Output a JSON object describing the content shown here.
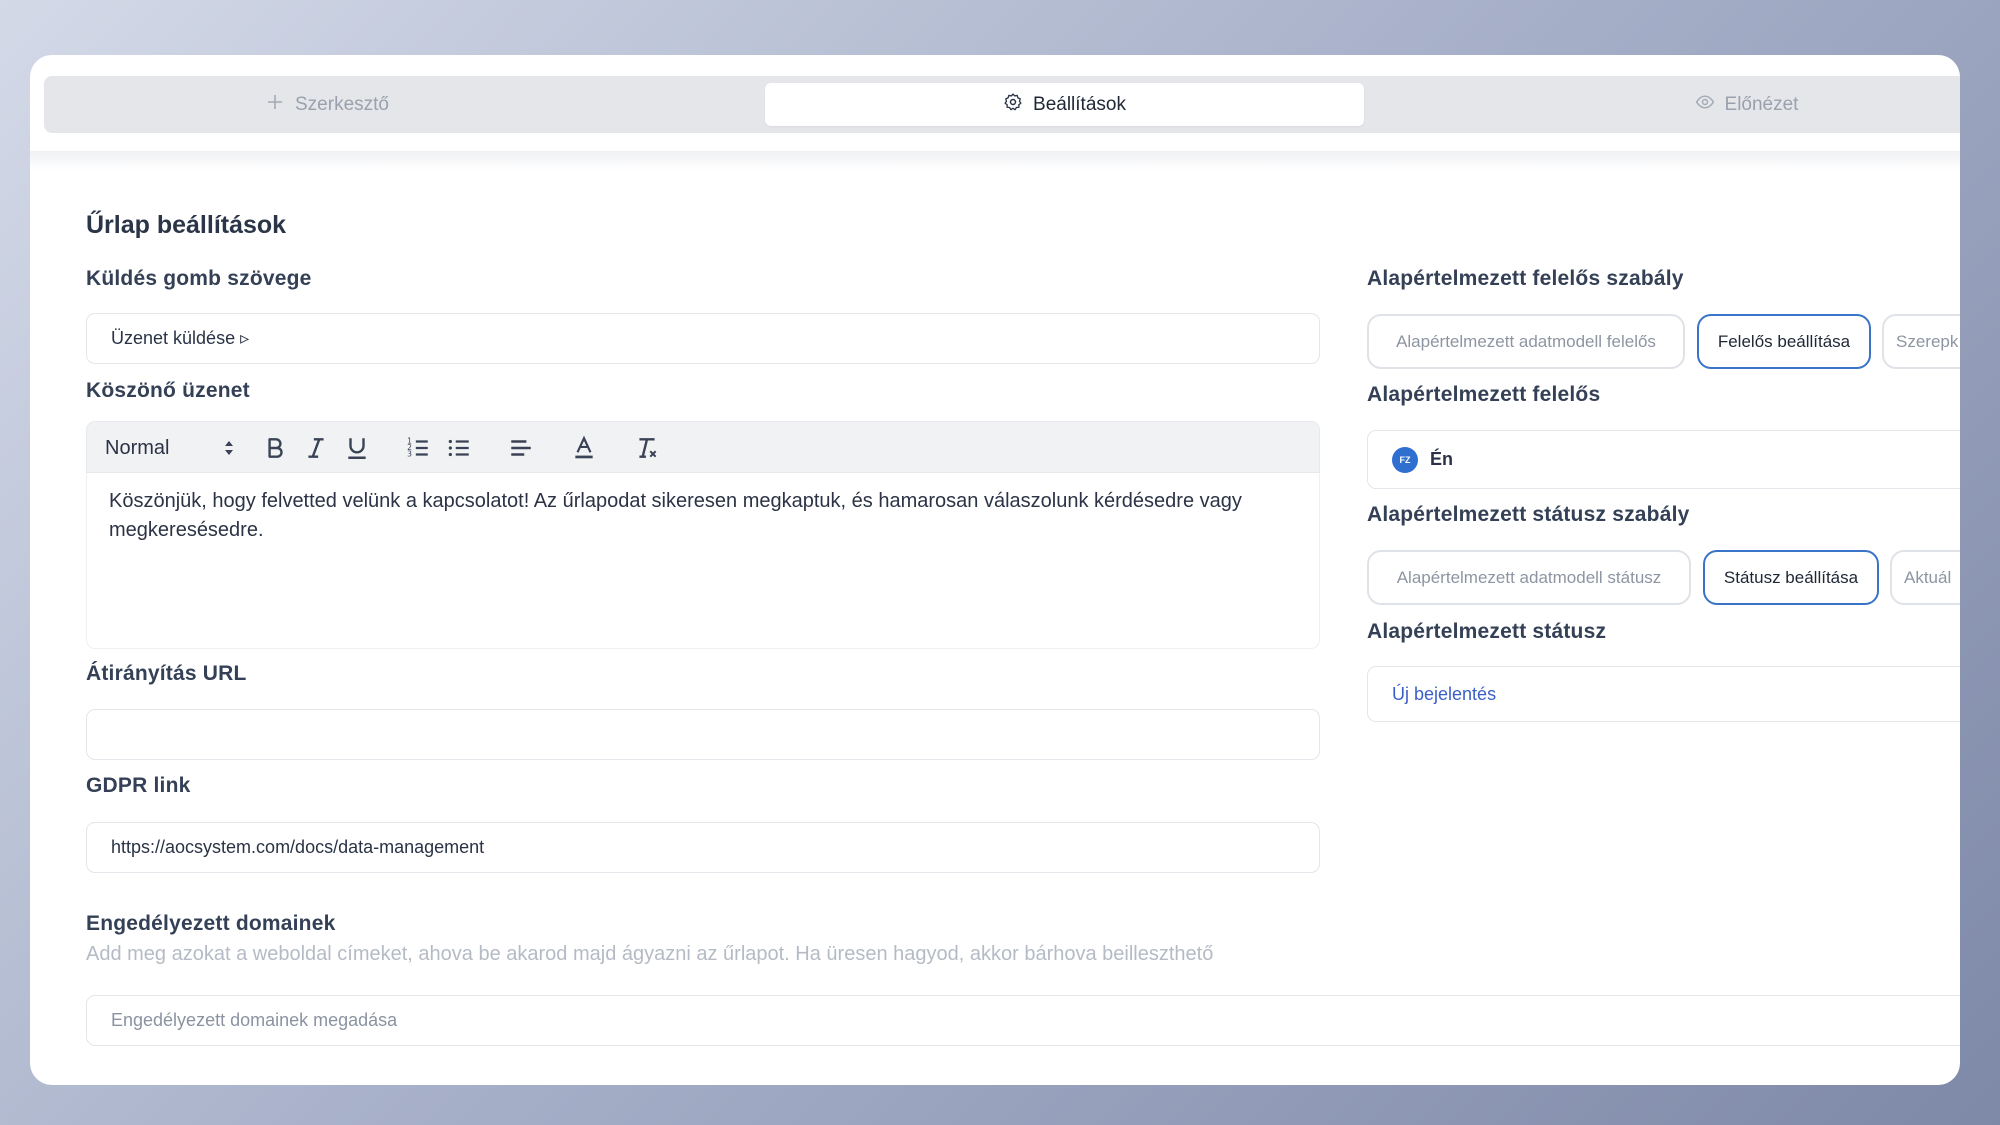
{
  "tabs": [
    {
      "label": "Szerkesztő",
      "icon": "plus-icon"
    },
    {
      "label": "Beállítások",
      "icon": "gear-icon"
    },
    {
      "label": "Előnézet",
      "icon": "eye-icon"
    }
  ],
  "page_title": "Űrlap beállítások",
  "submit": {
    "label": "Küldés gomb szövege",
    "value": "Üzenet küldése ▹"
  },
  "thanks": {
    "label": "Köszönő üzenet",
    "format": "Normal",
    "text": "Köszönjük, hogy felvetted velünk a kapcsolatot! Az űrlapodat sikeresen megkaptuk, és hamarosan válaszolunk kérdésedre vagy megkeresésedre."
  },
  "redirect": {
    "label": "Átirányítás URL",
    "value": ""
  },
  "gdpr": {
    "label": "GDPR link",
    "value": "https://aocsystem.com/docs/data-management"
  },
  "domains": {
    "label": "Engedélyezett domainek",
    "hint": "Add meg azokat a weboldal címeket, ahova be akarod majd ágyazni az űrlapot. Ha üresen hagyod, akkor bárhova beilleszthető",
    "placeholder": "Engedélyezett domainek megadása"
  },
  "owner_rule": {
    "label": "Alapértelmezett felelős szabály",
    "options": [
      "Alapértelmezett adatmodell felelős",
      "Felelős beállítása",
      "Szerepk"
    ],
    "selected": "Felelős beállítása"
  },
  "owner": {
    "label": "Alapértelmezett felelős",
    "avatar_initials": "FZ",
    "value": "Én"
  },
  "status_rule": {
    "label": "Alapértelmezett státusz szabály",
    "options": [
      "Alapértelmezett adatmodell státusz",
      "Státusz beállítása",
      "Aktuál"
    ],
    "selected": "Státusz beállítása"
  },
  "status": {
    "label": "Alapértelmezett státusz",
    "value": "Új bejelentés"
  },
  "colors": {
    "accent": "#3a74c8",
    "link": "#3b5fc8",
    "avatar": "#2f6fd0"
  }
}
